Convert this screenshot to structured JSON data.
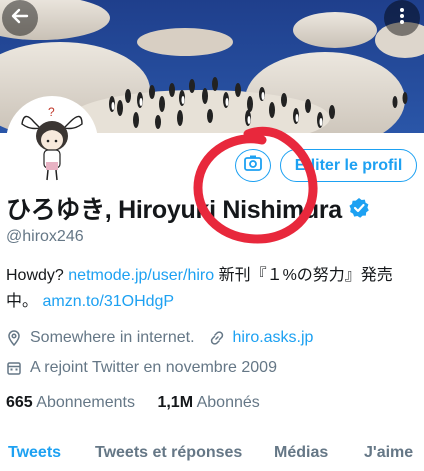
{
  "profile": {
    "display_name": "ひろゆき, Hiroyuki Nishimura",
    "handle": "@hirox246",
    "bio_intro": "Howdy?",
    "bio_link1": "netmode.jp/user/hiro",
    "bio_text": "新刊『１%の努力』発売中。",
    "bio_link2": "amzn.to/31OHdgP",
    "location": "Somewhere in internet.",
    "website": "hiro.asks.jp",
    "joined": "A rejoint Twitter en novembre 2009"
  },
  "stats": {
    "following_count": "665",
    "following_label": "Abonnements",
    "followers_count": "1,1M",
    "followers_label": "Abonnés"
  },
  "actions": {
    "edit_profile_label": "Éditer le profil"
  },
  "tabs": [
    {
      "label": "Tweets",
      "active": true
    },
    {
      "label": "Tweets et réponses",
      "active": false
    },
    {
      "label": "Médias",
      "active": false
    },
    {
      "label": "J'aime",
      "active": false
    }
  ],
  "icons": {
    "back": "arrow-left-icon",
    "more": "more-vertical-icon",
    "verified": "verified-badge-icon",
    "location": "location-pin-icon",
    "website": "link-icon",
    "joined": "calendar-icon",
    "camera": "camera-icon"
  },
  "colors": {
    "accent": "#1da1f2",
    "secondary_text": "#657786",
    "annotation": "#e8283c"
  }
}
